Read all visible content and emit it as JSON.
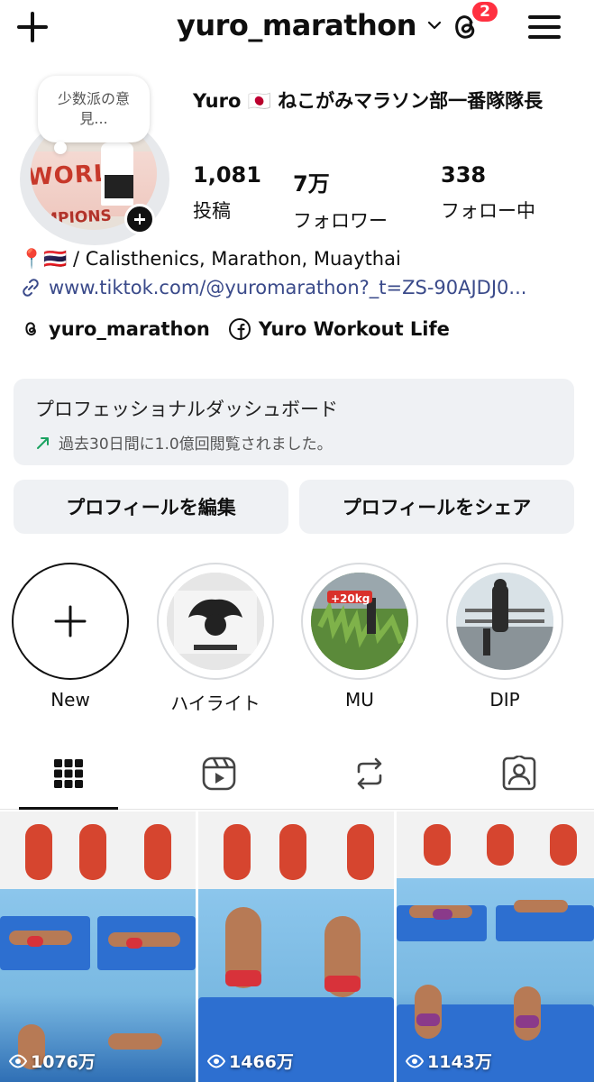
{
  "header": {
    "username": "yuro_marathon",
    "notification_count": "2"
  },
  "profile": {
    "note": "少数派の意見...",
    "display_name": "Yuro 🇯🇵 ねこがみマラソン部一番隊隊長",
    "stats": [
      {
        "value": "1,081",
        "label": "投稿"
      },
      {
        "value": "7万",
        "label": "フォロワー"
      },
      {
        "value": "338",
        "label": "フォロー中"
      }
    ],
    "bio": "📍🇹🇭 /  Calisthenics, Marathon, Muaythai",
    "link": "www.tiktok.com/@yuromarathon?_t=ZS-90AJDJ0...",
    "threads_handle": "yuro_marathon",
    "facebook_page": "Yuro Workout Life"
  },
  "dashboard": {
    "title": "プロフェッショナルダッシュボード",
    "subtitle": "過去30日間に1.0億回閲覧されました。"
  },
  "buttons": {
    "edit": "プロフィールを編集",
    "share": "プロフィールをシェア"
  },
  "highlights": [
    {
      "label": "New"
    },
    {
      "label": "ハイライト"
    },
    {
      "label": "MU",
      "tag": "+20kg"
    },
    {
      "label": "DIP"
    }
  ],
  "tabs": [
    "grid-icon",
    "reels-icon",
    "reposts-icon",
    "tagged-icon"
  ],
  "posts": [
    {
      "views": "1076万"
    },
    {
      "views": "1466万"
    },
    {
      "views": "1143万"
    }
  ],
  "colors": {
    "badge": "#ff3040",
    "link": "#3a4a8a",
    "trend": "#1aa260",
    "button_bg": "#eff1f4"
  }
}
